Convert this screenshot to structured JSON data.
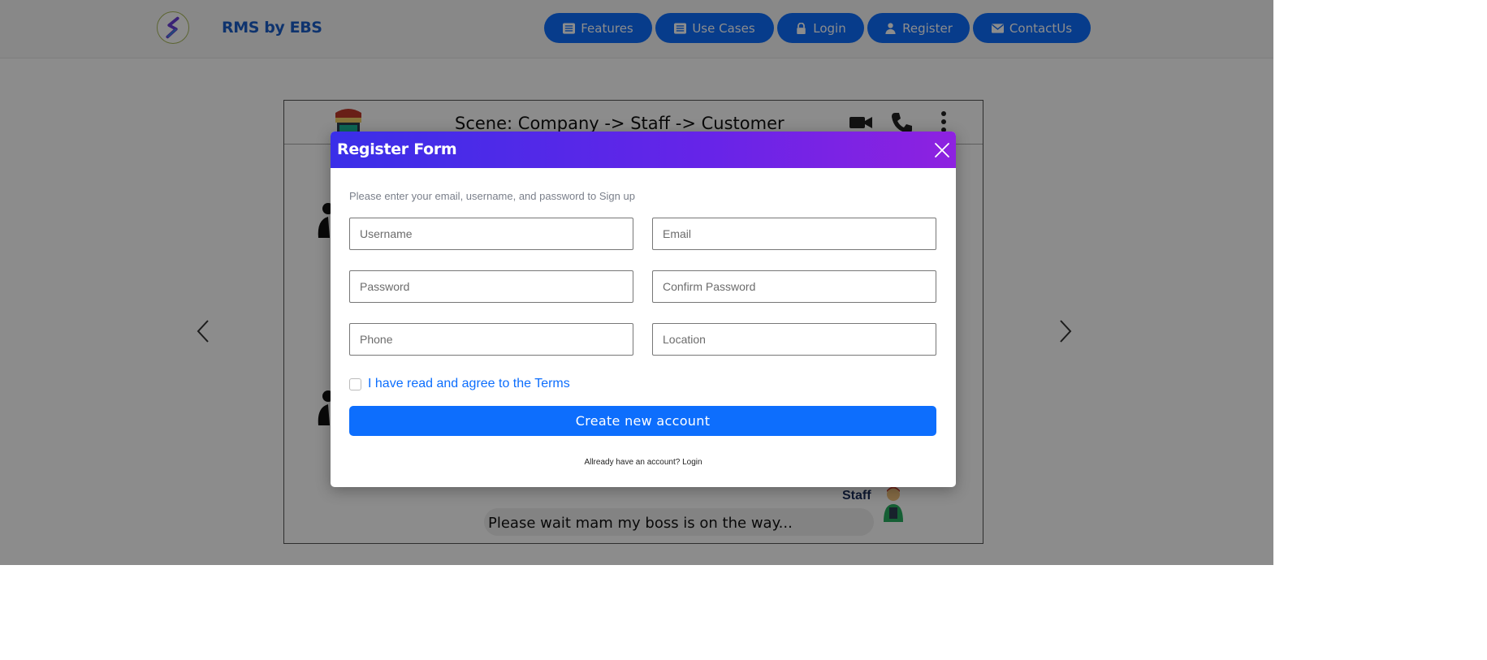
{
  "brand": {
    "name": "RMS by EBS"
  },
  "nav": [
    {
      "label": "Features",
      "icon": "list-icon"
    },
    {
      "label": "Use Cases",
      "icon": "list-icon"
    },
    {
      "label": "Login",
      "icon": "lock-icon"
    },
    {
      "label": "Register",
      "icon": "user-icon"
    },
    {
      "label": "ContactUs",
      "icon": "envelope-icon"
    }
  ],
  "scene": {
    "title": "Scene: Company -> Staff -> Customer",
    "speaker": "Staff",
    "message": "Please wait mam my boss is on the way..."
  },
  "modal": {
    "title": "Register Form",
    "hint": "Please enter your email, username, and password to Sign up",
    "fields": {
      "username": "Username",
      "email": "Email",
      "password": "Password",
      "confirm_password": "Confirm Password",
      "phone": "Phone",
      "location": "Location"
    },
    "terms_label": "I have read and agree to the Terms",
    "submit_label": "Create new account",
    "login_prompt": "Allready have an account? Login"
  },
  "colors": {
    "primary": "#0d6efd",
    "header_gradient_start": "#3a2fe8",
    "header_gradient_end": "#8e22e0",
    "brand_text": "#1a5ec9"
  }
}
